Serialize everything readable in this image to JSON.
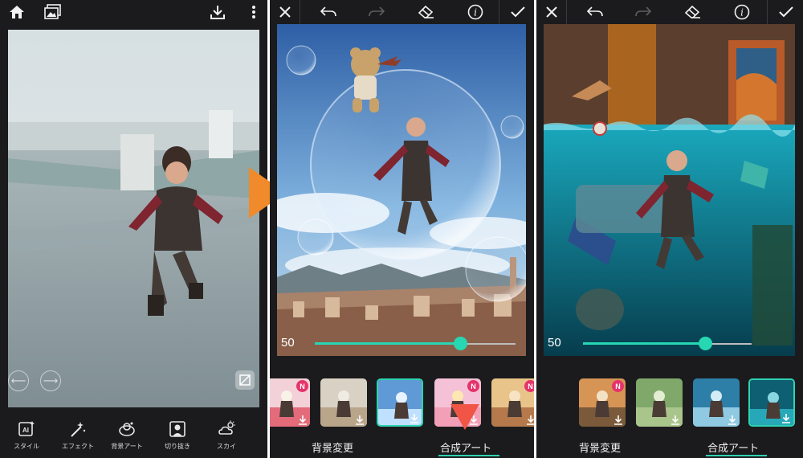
{
  "editor": {
    "tools": [
      {
        "label": "スタイル",
        "icon": "ai-style-icon"
      },
      {
        "label": "エフェクト",
        "icon": "magic-wand-icon"
      },
      {
        "label": "背景アート",
        "icon": "background-art-icon"
      },
      {
        "label": "切り抜き",
        "icon": "cutout-icon"
      },
      {
        "label": "スカイ",
        "icon": "sky-icon"
      }
    ]
  },
  "blend_left": {
    "slider_value": "50",
    "slider_level": 0.5,
    "tabs": [
      {
        "label": "背景変更",
        "selected": false
      },
      {
        "label": "合成アート",
        "selected": true
      }
    ],
    "thumbs": [
      {
        "badge": "N",
        "selected": false
      },
      {
        "badge": "",
        "selected": false
      },
      {
        "badge": "",
        "selected": true
      },
      {
        "badge": "N",
        "selected": false
      },
      {
        "badge": "N",
        "selected": false
      }
    ]
  },
  "blend_right": {
    "slider_value": "50",
    "slider_level": 0.5,
    "tabs": [
      {
        "label": "背景変更",
        "selected": false
      },
      {
        "label": "合成アート",
        "selected": true
      }
    ],
    "thumbs": [
      {
        "badge": "N",
        "selected": false
      },
      {
        "badge": "",
        "selected": false
      },
      {
        "badge": "",
        "selected": false
      },
      {
        "badge": "",
        "selected": true
      }
    ]
  },
  "colors": {
    "accent": "#2ed3b1",
    "arrow": "#f08a2a",
    "badge": "#e5336b",
    "panel_bg": "#1b1b1d"
  }
}
